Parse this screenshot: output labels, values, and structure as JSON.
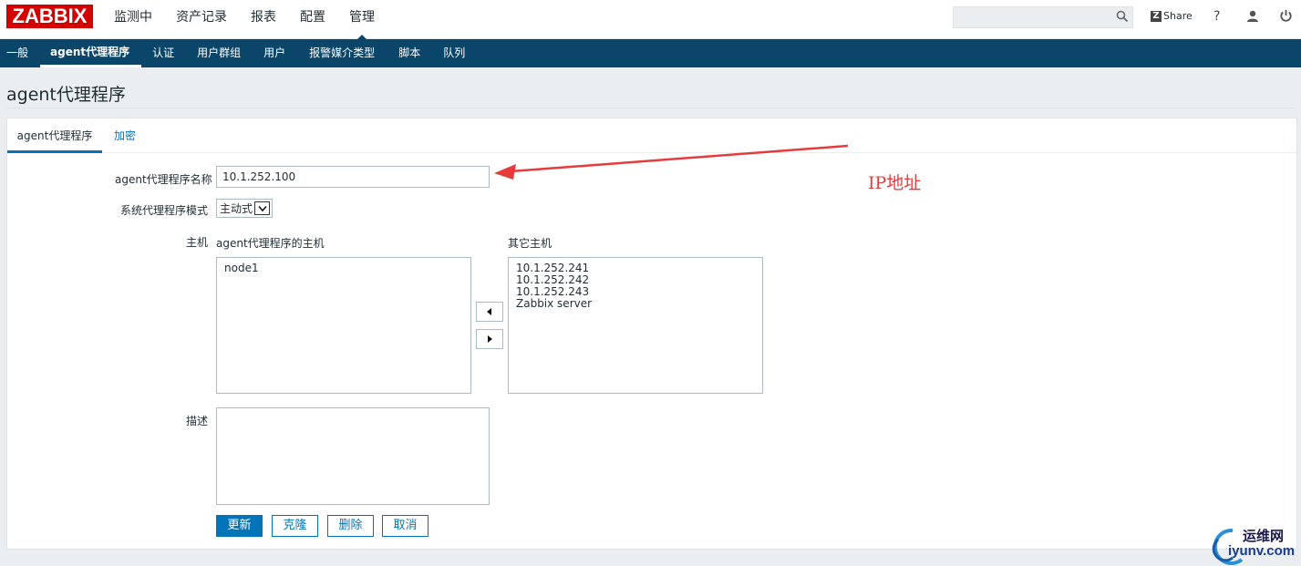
{
  "header": {
    "logo_text": "ZABBIX",
    "logo_color": "#d40000",
    "main_menu": [
      {
        "label": "监测中",
        "active": false
      },
      {
        "label": "资产记录",
        "active": false
      },
      {
        "label": "报表",
        "active": false
      },
      {
        "label": "配置",
        "active": false
      },
      {
        "label": "管理",
        "active": true
      }
    ],
    "search_value": "",
    "search_icon": "search-icon",
    "share_label": "Share",
    "help_label": "?",
    "user_icon": "user-icon",
    "power_icon": "power-icon"
  },
  "subnav": {
    "items": [
      {
        "label": "一般",
        "active": false
      },
      {
        "label": "agent代理程序",
        "active": true
      },
      {
        "label": "认证",
        "active": false
      },
      {
        "label": "用户群组",
        "active": false
      },
      {
        "label": "用户",
        "active": false
      },
      {
        "label": "报警媒介类型",
        "active": false
      },
      {
        "label": "脚本",
        "active": false
      },
      {
        "label": "队列",
        "active": false
      }
    ],
    "background": "#0a466a"
  },
  "page_title": "agent代理程序",
  "tabs": [
    {
      "label": "agent代理程序",
      "active": true
    },
    {
      "label": "加密",
      "active": false
    }
  ],
  "form": {
    "proxy_name_label": "agent代理程序名称",
    "proxy_name_value": "10.1.252.100",
    "mode_label": "系统代理程序模式",
    "mode_value": "主动式",
    "hosts_label": "主机",
    "proxy_hosts_label": "agent代理程序的主机",
    "proxy_hosts": [
      "node1"
    ],
    "other_hosts_label": "其它主机",
    "other_hosts": [
      "10.1.252.241",
      "10.1.252.242",
      "10.1.252.243",
      "Zabbix server"
    ],
    "description_label": "描述",
    "description_value": ""
  },
  "buttons": {
    "update": "更新",
    "clone": "克隆",
    "delete": "删除",
    "cancel": "取消"
  },
  "annotation": {
    "text": "IP地址",
    "color": "#e53b3b"
  },
  "watermark": {
    "line1": "运维网",
    "line2": "iyunv.com"
  }
}
